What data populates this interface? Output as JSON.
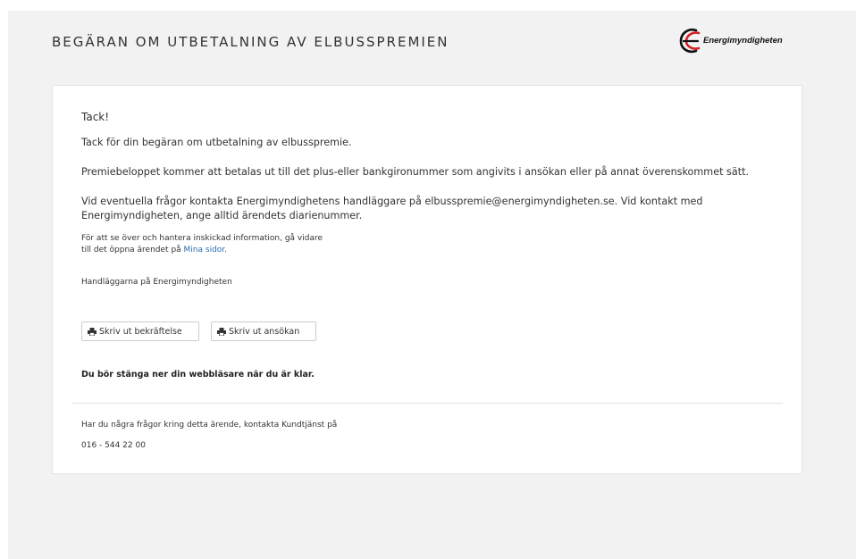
{
  "header": {
    "title": "BEGÄRAN OM UTBETALNING AV ELBUSSPREMIEN",
    "logo_text": "Energimyndigheten"
  },
  "content": {
    "heading": "Tack!",
    "p1": "Tack för din begäran om utbetalning av elbusspremie.",
    "p2": "Premiebeloppet kommer att betalas ut till det plus-eller bankgironummer som angivits i ansökan eller på annat överenskommet sätt.",
    "p3": "Vid eventuella frågor kontakta Energimyndighetens handläggare på elbusspremie@energimyndigheten.se. Vid kontakt med Energimyndigheten, ange alltid ärendets diarienummer.",
    "small_line1": "För att se över och hantera inskickad information, gå vidare",
    "small_line2_prefix": "till det öppna ärendet på ",
    "mina_sidor_link": "Mina sidor",
    "small_line2_suffix": ".",
    "signature": "Handläggarna på Energimyndigheten",
    "close_note": "Du bör stänga ner din webbläsare när du är klar."
  },
  "buttons": {
    "print_confirmation": "Skriv ut bekräftelse",
    "print_application": "Skriv ut ansökan"
  },
  "footer": {
    "contact_text": "Har du några frågor kring detta ärende, kontakta Kundtjänst på",
    "phone": "016 - 544 22 00"
  },
  "icons": {
    "printer": "printer-icon",
    "logo": "energimyndigheten-logo-icon"
  },
  "colors": {
    "link": "#2a6db0",
    "logo_red": "#d42027"
  }
}
